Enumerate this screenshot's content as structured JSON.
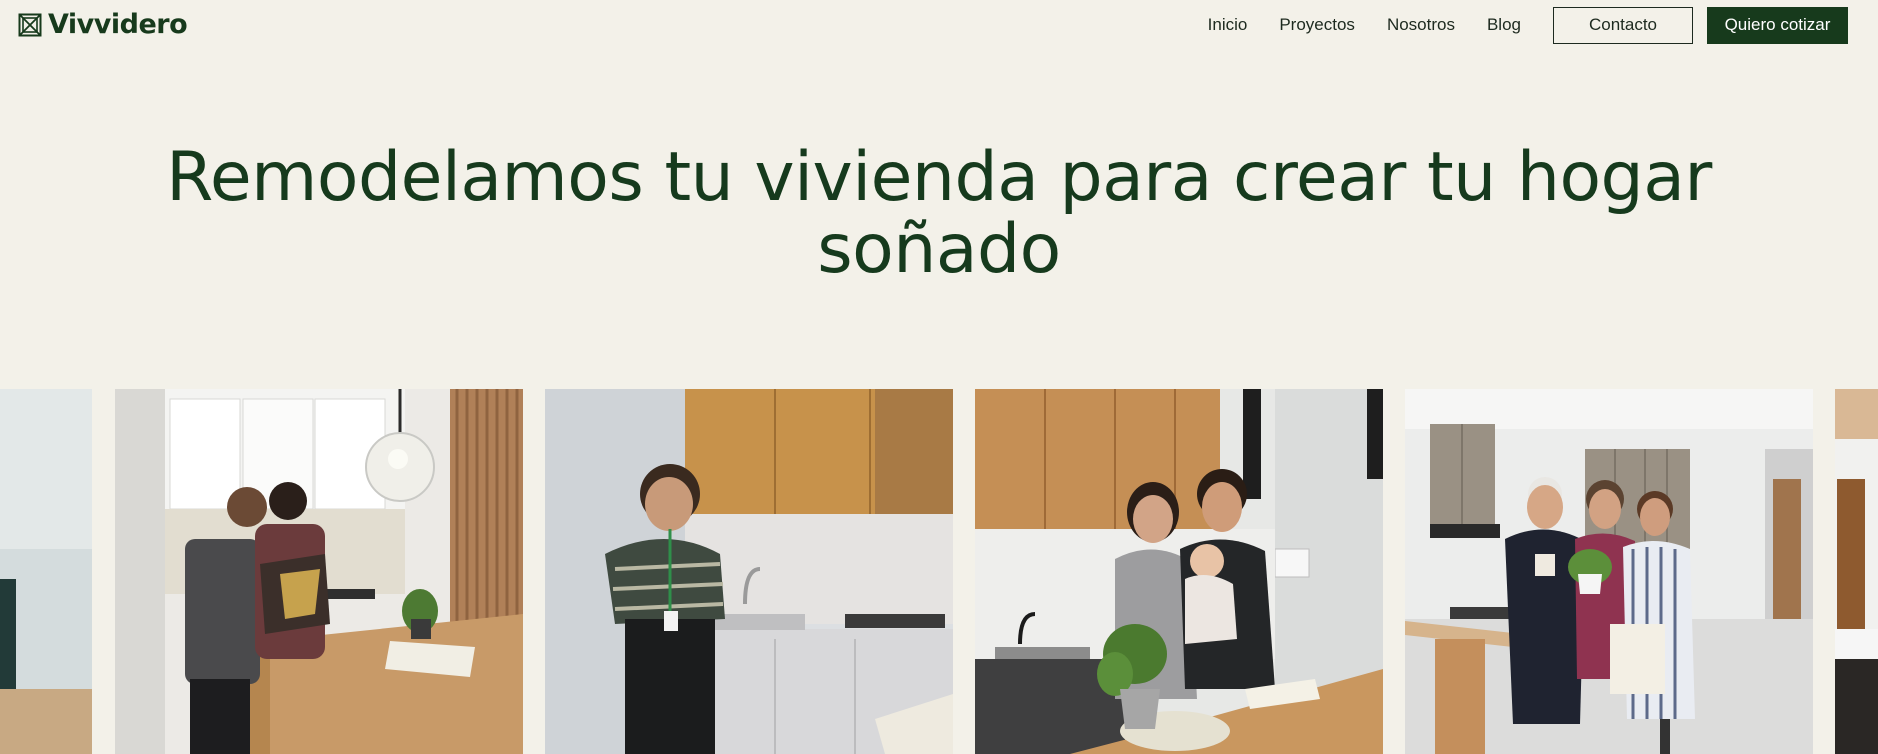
{
  "brand": {
    "name": "Vivvidero",
    "logo_icon": "frame-x-logo-icon",
    "color": "#173a1c"
  },
  "nav": {
    "links": [
      "Inicio",
      "Proyectos",
      "Nosotros",
      "Blog"
    ],
    "contact_label": "Contacto",
    "quote_label": "Quiero cotizar"
  },
  "hero": {
    "title_line1": "Remodelamos tu vivienda para crear tu hogar",
    "title_line2": "soñado"
  },
  "gallery": {
    "photos": [
      {
        "subject": "partial kitchen edge"
      },
      {
        "subject": "couple embracing in white kitchen with slatted wood panel"
      },
      {
        "subject": "woman with lanyard in kitchen with wood upper cabinets"
      },
      {
        "subject": "family with baby in kitchen with wood cabinets and plant"
      },
      {
        "subject": "three people at kitchen island with plant"
      },
      {
        "subject": "partial doorway"
      }
    ]
  },
  "colors": {
    "background": "#f3f1e9",
    "accent": "#173a1c"
  }
}
